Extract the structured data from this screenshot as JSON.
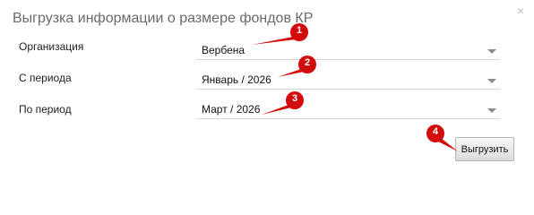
{
  "dialog": {
    "title": "Выгрузка информации о размере фондов КР",
    "close_glyph": "×"
  },
  "form": {
    "organization": {
      "label": "Организация",
      "value": "Вербена"
    },
    "from_period": {
      "label": "С периода",
      "value": "Январь / 2026"
    },
    "to_period": {
      "label": "По период",
      "value": "Март / 2026"
    }
  },
  "actions": {
    "export_label": "Выгрузить"
  },
  "markers": [
    "1",
    "2",
    "3",
    "4"
  ],
  "colors": {
    "marker_red": "#d20c0c",
    "title_gray": "#6a6a6a"
  }
}
